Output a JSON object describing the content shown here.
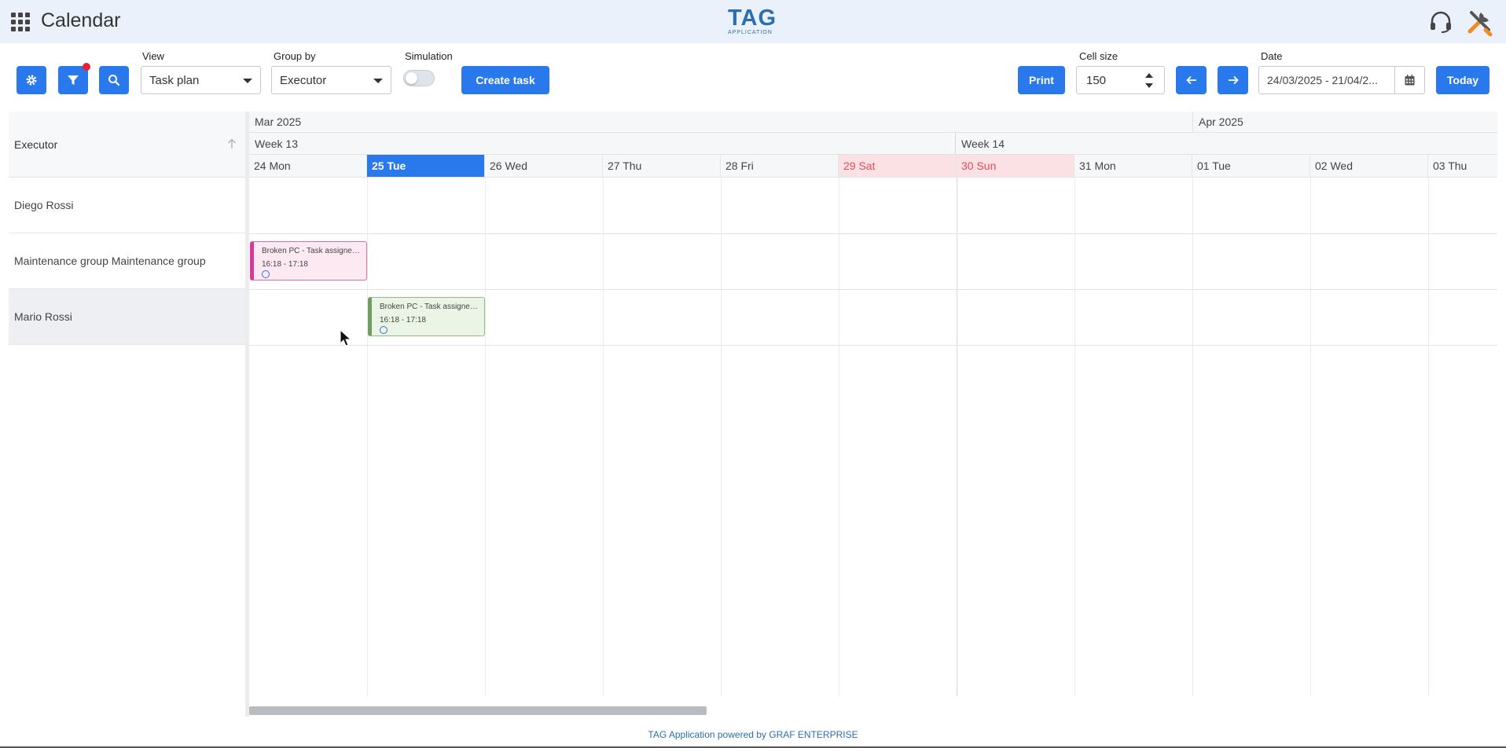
{
  "header": {
    "title": "Calendar",
    "logo_main": "TAG",
    "logo_sub": "APPLICATION",
    "icons": [
      "apps-grid-icon",
      "headset-icon",
      "tools-icon"
    ]
  },
  "toolbar": {
    "view_label": "View",
    "view_value": "Task plan",
    "groupby_label": "Group by",
    "groupby_value": "Executor",
    "simulation_label": "Simulation",
    "simulation_on": false,
    "create_task_label": "Create task",
    "print_label": "Print",
    "cellsize_label": "Cell size",
    "cellsize_value": "150",
    "date_label": "Date",
    "date_value": "24/03/2025 - 21/04/2...",
    "today_label": "Today",
    "accent_color": "#2a79ec"
  },
  "grid": {
    "column_header": "Executor",
    "months": [
      {
        "label": "Mar 2025"
      },
      {
        "label": "Apr 2025"
      }
    ],
    "weeks": [
      {
        "label": "Week 13"
      },
      {
        "label": "Week 14"
      }
    ],
    "days": [
      {
        "label": "24 Mon",
        "state": "normal"
      },
      {
        "label": "25 Tue",
        "state": "today"
      },
      {
        "label": "26 Wed",
        "state": "normal"
      },
      {
        "label": "27 Thu",
        "state": "normal"
      },
      {
        "label": "28 Fri",
        "state": "normal"
      },
      {
        "label": "29 Sat",
        "state": "weekend"
      },
      {
        "label": "30 Sun",
        "state": "weekend"
      },
      {
        "label": "31 Mon",
        "state": "normal"
      },
      {
        "label": "01 Tue",
        "state": "normal"
      },
      {
        "label": "02 Wed",
        "state": "normal"
      },
      {
        "label": "03 Thu",
        "state": "normal"
      }
    ],
    "rows": [
      {
        "label": "Diego Rossi"
      },
      {
        "label": "Maintenance group Maintenance group"
      },
      {
        "label": "Mario Rossi"
      }
    ],
    "tasks": [
      {
        "title": "Broken PC - Task assigned to Maintenance group",
        "time": "16:18 - 17:18",
        "row": 1,
        "day": 0,
        "color": "pink"
      },
      {
        "title": "Broken PC - Task assigned to Mario Rossi",
        "time": "16:18 - 17:18",
        "row": 2,
        "day": 1,
        "color": "green"
      }
    ]
  },
  "footer": {
    "text": "TAG Application powered by GRAF ENTERPRISE"
  }
}
